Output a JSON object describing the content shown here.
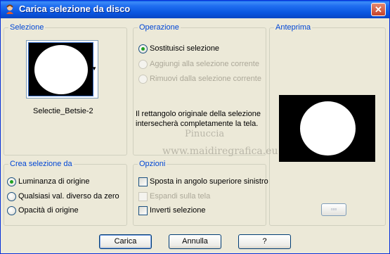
{
  "window": {
    "title": "Carica selezione da disco",
    "close_glyph": "✕"
  },
  "selezione": {
    "group_title": "Selezione",
    "selected_name": "Selectie_Betsie-2",
    "dropdown_glyph": "▼"
  },
  "operazione": {
    "group_title": "Operazione",
    "options": [
      {
        "label": "Sostituisci selezione",
        "checked": true,
        "enabled": true
      },
      {
        "label": "Aggiungi alla selezione corrente",
        "checked": false,
        "enabled": false
      },
      {
        "label": "Rimuovi dalla selezione corrente",
        "checked": false,
        "enabled": false
      }
    ],
    "info": "Il rettangolo originale della selezione intersecherà completamente la tela."
  },
  "anteprima": {
    "group_title": "Anteprima",
    "small_button_glyph": "▫▫▫"
  },
  "crea": {
    "group_title": "Crea selezione da",
    "options": [
      {
        "label": "Luminanza di origine",
        "checked": true
      },
      {
        "label": "Qualsiasi val. diverso da zero",
        "checked": false
      },
      {
        "label": "Opacità di origine",
        "checked": false
      }
    ]
  },
  "opzioni": {
    "group_title": "Opzioni",
    "options": [
      {
        "label": "Sposta in angolo superiore sinistro",
        "checked": false,
        "enabled": true
      },
      {
        "label": "Espandi sulla tela",
        "checked": false,
        "enabled": false
      },
      {
        "label": "Inverti selezione",
        "checked": false,
        "enabled": true
      }
    ]
  },
  "watermark": {
    "line1": "Pinuccia",
    "line2": "www.maidiregrafica.eu"
  },
  "buttons": {
    "load": "Carica",
    "cancel": "Annulla",
    "help": "?"
  }
}
